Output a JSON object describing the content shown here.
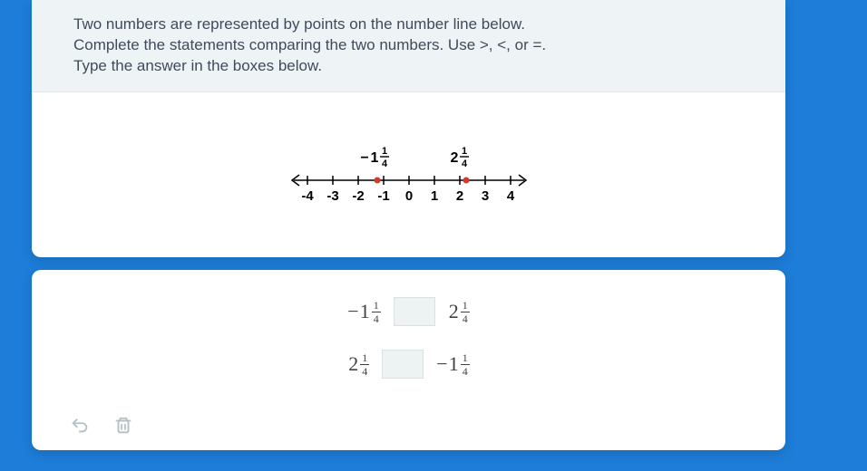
{
  "instructions": {
    "line1": "Two numbers are represented by points on the number line below.",
    "line2": "Complete the statements comparing the two numbers. Use >, <, or =.",
    "line3": "Type the answer in the boxes below."
  },
  "numberline": {
    "ticks": [
      "-4",
      "-3",
      "-2",
      "-1",
      "0",
      "1",
      "2",
      "3",
      "4"
    ],
    "points": [
      {
        "neg": "−",
        "whole": "1",
        "num": "1",
        "den": "4",
        "value": -1.25
      },
      {
        "neg": "",
        "whole": "2",
        "num": "1",
        "den": "4",
        "value": 2.25
      }
    ]
  },
  "comparisons": [
    {
      "left": {
        "neg": "−",
        "whole": "1",
        "num": "1",
        "den": "4"
      },
      "right": {
        "neg": "",
        "whole": "2",
        "num": "1",
        "den": "4"
      },
      "answer": ""
    },
    {
      "left": {
        "neg": "",
        "whole": "2",
        "num": "1",
        "den": "4"
      },
      "right": {
        "neg": "−",
        "whole": "1",
        "num": "1",
        "den": "4"
      },
      "answer": ""
    }
  ],
  "icons": {
    "undo": "undo-icon",
    "trash": "trash-icon"
  },
  "colors": {
    "point": "#d23b2a",
    "axis": "#000000",
    "text": "#3f4b5b"
  }
}
